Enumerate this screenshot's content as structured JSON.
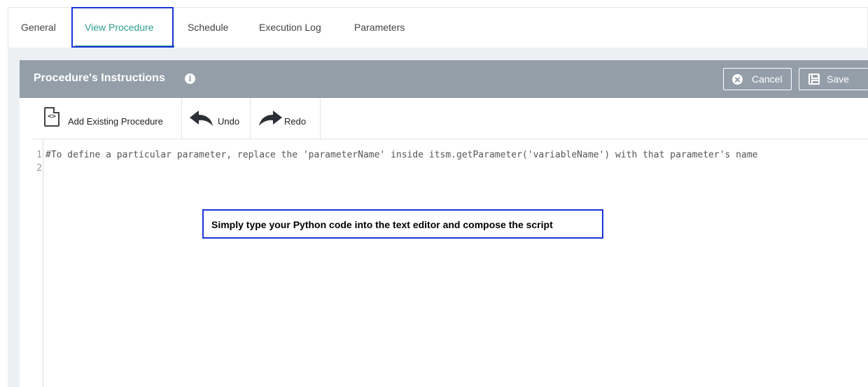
{
  "tabs": [
    {
      "label": "General"
    },
    {
      "label": "View Procedure"
    },
    {
      "label": "Schedule"
    },
    {
      "label": "Execution Log"
    },
    {
      "label": "Parameters"
    }
  ],
  "active_tab": "View Procedure",
  "panel": {
    "title": "Procedure's Instructions",
    "info_icon": "i",
    "cancel_label": "Cancel",
    "save_label": "Save"
  },
  "toolbar": {
    "add_existing_label": "Add Existing Procedure",
    "add_existing_icon_glyph": "<>",
    "undo_label": "Undo",
    "redo_label": "Redo"
  },
  "editor": {
    "line_numbers": [
      "1",
      "2"
    ],
    "lines": [
      "#To define a particular parameter, replace the 'parameterName' inside itsm.getParameter('variableName') with that parameter's name",
      ""
    ]
  },
  "annotation": {
    "text": "Simply type your Python code into the text editor and compose the script"
  },
  "colors": {
    "accent": "#2e9c8c",
    "header_bg": "#939ea9",
    "highlight_border": "#1a35d8",
    "page_bg": "#edf0f3"
  },
  "icons": {
    "info": "info-icon",
    "cancel": "x-circle-icon",
    "save": "floppy-disk-icon",
    "add_existing": "code-file-icon",
    "undo": "undo-arrow-icon",
    "redo": "redo-arrow-icon"
  }
}
